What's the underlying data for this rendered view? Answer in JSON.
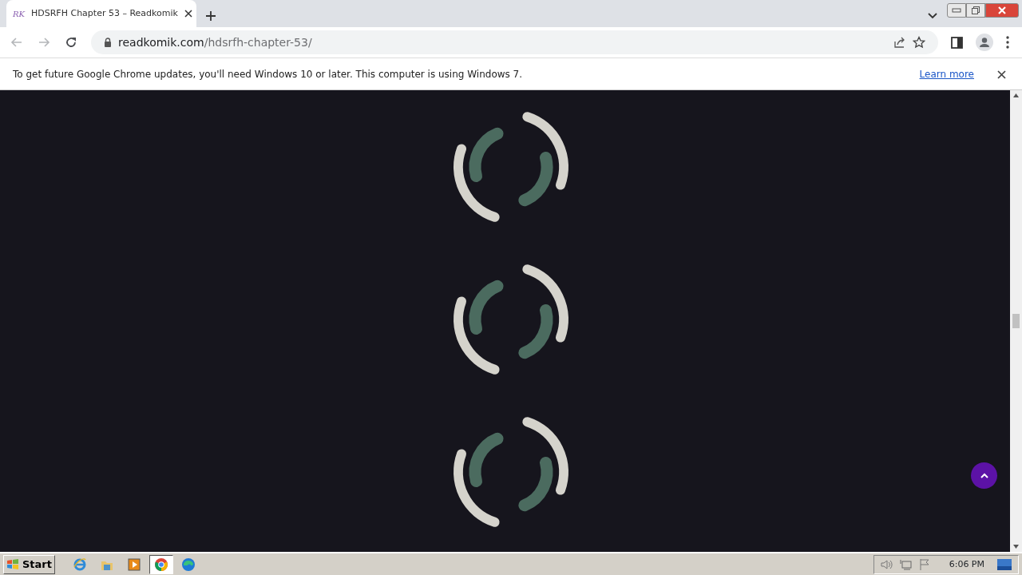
{
  "browser": {
    "tab": {
      "title": "HDSRFH Chapter 53 – Readkomik",
      "favicon": "RK",
      "selected": true
    },
    "nav_buttons": [
      {
        "kind": "back",
        "disabled": true
      },
      {
        "kind": "forward",
        "disabled": true
      },
      {
        "kind": "reload",
        "disabled": false
      }
    ],
    "address": {
      "host": "readkomik.com",
      "path": "/hdsrfh-chapter-53/"
    }
  },
  "infobar": {
    "message": "To get future Google Chrome updates, you'll need Windows 10 or later. This computer is using Windows 7.",
    "link": "Learn more"
  },
  "content": {
    "spinners": [
      {
        "kind": "spinner"
      },
      {
        "kind": "spinner"
      },
      {
        "kind": "spinner"
      }
    ]
  },
  "taskbar": {
    "start": "Start",
    "apps": [
      {
        "kind": "ie",
        "selected": false
      },
      {
        "kind": "folder",
        "selected": false
      },
      {
        "kind": "media",
        "selected": false
      },
      {
        "kind": "chrome",
        "selected": true
      },
      {
        "kind": "edge",
        "selected": false
      }
    ],
    "clock": "6:06 PM"
  }
}
